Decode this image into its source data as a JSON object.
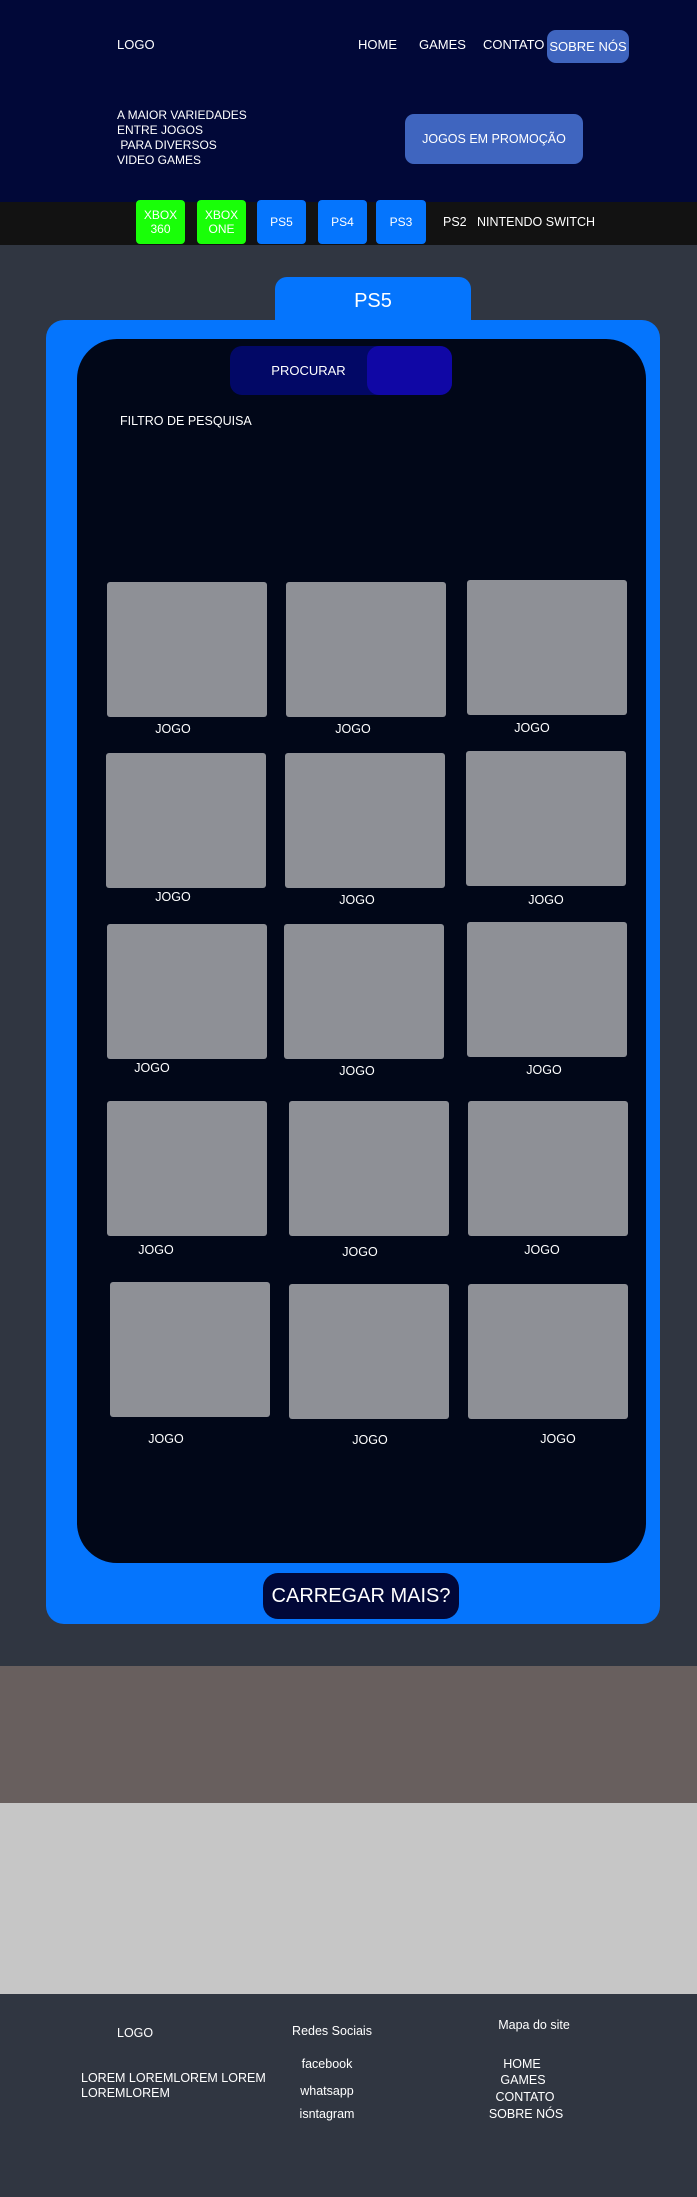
{
  "header": {
    "logo": "LOGO",
    "nav": [
      "HOME",
      "GAMES",
      "CONTATO",
      "SOBRE NÓS"
    ],
    "tagline": "A MAIOR VARIEDADES\nENTRE JOGOS\n PARA DIVERSOS\nVIDEO GAMES",
    "promo_button": "JOGOS EM PROMOÇÃO"
  },
  "consoles": [
    "XBOX 360",
    "XBOX ONE",
    "PS5",
    "PS4",
    "PS3",
    "PS2",
    "NINTENDO SWITCH"
  ],
  "main": {
    "tab_title": "PS5",
    "search_label": "PROCURAR",
    "filter_label": "FILTRO DE PESQUISA",
    "game_label": "JOGO",
    "load_more": "CARREGAR MAIS?"
  },
  "footer": {
    "logo": "LOGO",
    "text": "LOREM LOREMLOREM LOREM\nLOREMLOREM",
    "social_title": "Redes  Sociais",
    "social_links": [
      "facebook",
      "whatsapp",
      "isntagram"
    ],
    "sitemap_title": "Mapa do site",
    "sitemap_links": [
      "HOME",
      "GAMES",
      "CONTATO",
      "SOBRE NÓS"
    ]
  },
  "colors": {
    "header_bg": "#010838",
    "accent_blue": "#0575fd",
    "green": "#19ff08",
    "page_bg": "#303641"
  }
}
